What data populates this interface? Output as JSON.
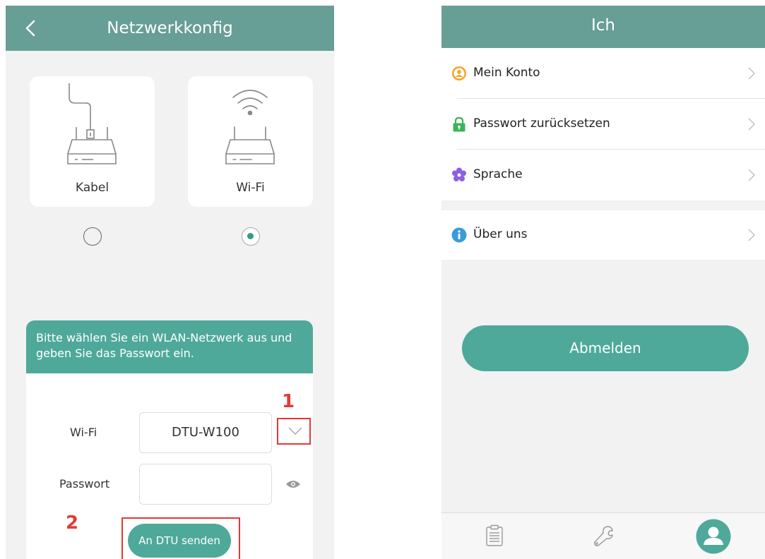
{
  "left_screen": {
    "header": {
      "title": "Netzwerkkonfig",
      "back_icon": "chevron-left-icon"
    },
    "options": [
      {
        "label": "Kabel",
        "icon": "cable-router-icon",
        "selected": false
      },
      {
        "label": "Wi-Fi",
        "icon": "wifi-router-icon",
        "selected": true
      }
    ],
    "panel": {
      "instruction": "Bitte wählen Sie ein WLAN-Netzwerk aus und geben Sie das Passwort ein.",
      "wifi_label": "Wi-Fi",
      "wifi_value": "DTU-W100",
      "password_label": "Passwort",
      "password_value": "",
      "send_button": "An DTU senden"
    },
    "annotations": {
      "step1": "1",
      "step2": "2"
    }
  },
  "right_screen": {
    "header": {
      "title": "Ich"
    },
    "menu": [
      {
        "label": "Mein Konto",
        "icon": "user-circle-icon"
      },
      {
        "label": "Passwort zurücksetzen",
        "icon": "lock-icon"
      },
      {
        "label": "Sprache",
        "icon": "flower-settings-icon"
      }
    ],
    "menu2": [
      {
        "label": "Über uns",
        "icon": "info-icon"
      }
    ],
    "logout_button": "Abmelden",
    "tabs": [
      {
        "icon": "clipboard-icon"
      },
      {
        "icon": "wrench-icon"
      },
      {
        "icon": "user-icon",
        "active": true
      }
    ]
  },
  "colors": {
    "header": "#679e95",
    "accent": "#4ea99a",
    "annotation_red": "#e53935",
    "background": "#f2f2f2"
  }
}
